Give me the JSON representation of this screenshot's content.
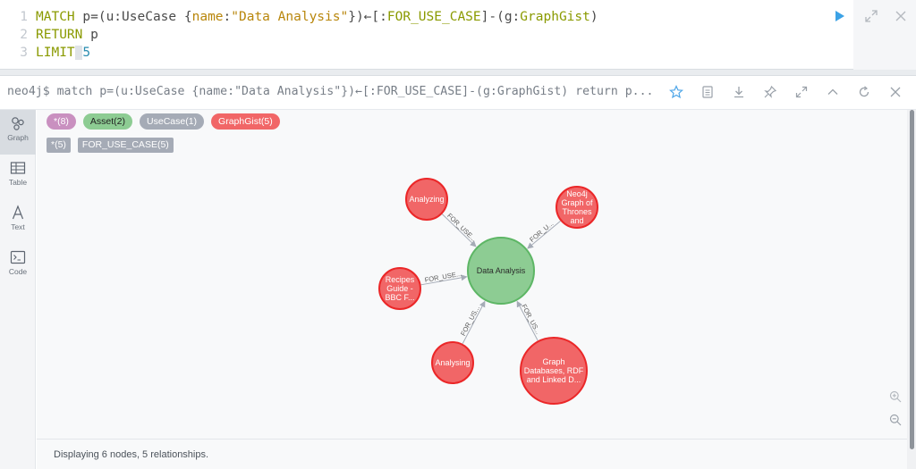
{
  "editor": {
    "line_numbers": [
      "1",
      "2",
      "3"
    ],
    "line1": {
      "kw": "MATCH",
      "a": " p=(u:UseCase {",
      "prop": "name",
      "b": ":",
      "str": "\"Data Analysis\"",
      "c": "})←[:",
      "rel": "FOR_USE_CASE",
      "d": "]-(g:",
      "lbl": "GraphGist",
      "e": ")"
    },
    "line2": {
      "kw": "RETURN",
      "rest": " p"
    },
    "line3": {
      "kw": "LIMIT",
      "num": "5"
    },
    "icons": [
      "play-icon",
      "expand-icon",
      "close-icon"
    ]
  },
  "frame": {
    "query": "neo4j$ match p=(u:UseCase {name:\"Data Analysis\"})←[:FOR_USE_CASE]-(g:GraphGist) return p...",
    "header_icons": [
      "star-icon",
      "save-icon",
      "download-icon",
      "pin-icon",
      "expand-icon",
      "collapse-icon",
      "rerun-icon",
      "close-icon"
    ]
  },
  "sidebar": {
    "items": [
      {
        "label": "Graph",
        "icon": "graph-icon"
      },
      {
        "label": "Table",
        "icon": "table-icon"
      },
      {
        "label": "Text",
        "icon": "text-icon"
      },
      {
        "label": "Code",
        "icon": "code-icon"
      }
    ]
  },
  "legend": {
    "labels": [
      {
        "text": "*(8)",
        "color": "#c990c0"
      },
      {
        "text": "Asset(2)",
        "color": "#8dcc93"
      },
      {
        "text": "UseCase(1)",
        "color": "#a5abb6"
      },
      {
        "text": "GraphGist(5)",
        "color": "#f16667"
      }
    ],
    "relationships": [
      {
        "text": "*(5)"
      },
      {
        "text": "FOR_USE_CASE(5)"
      }
    ]
  },
  "graph": {
    "center": {
      "lines": [
        "Data Analysis"
      ],
      "color": "#8dcc93",
      "border": "#5db665"
    },
    "gist_color": "#f16667",
    "gist_border": "#eb2728",
    "nodes": [
      {
        "lines": [
          "Analyzing"
        ]
      },
      {
        "lines": [
          "Neo4j",
          "Graph of",
          "Thrones",
          "and"
        ]
      },
      {
        "lines": [
          "Recipes",
          "Guide -",
          "BBC F..."
        ]
      },
      {
        "lines": [
          "Analysing"
        ]
      },
      {
        "lines": [
          "Graph",
          "Databases, RDF",
          "and Linked D..."
        ]
      }
    ],
    "rel_labels": [
      "FOR_USE...",
      "FOR_U...",
      "FOR_USE...",
      "FOR_US...",
      "FOR_US..."
    ]
  },
  "status": {
    "text": "Displaying 6 nodes, 5 relationships."
  },
  "zoom": {
    "icons": [
      "zoom-in-icon",
      "zoom-out-icon"
    ]
  }
}
